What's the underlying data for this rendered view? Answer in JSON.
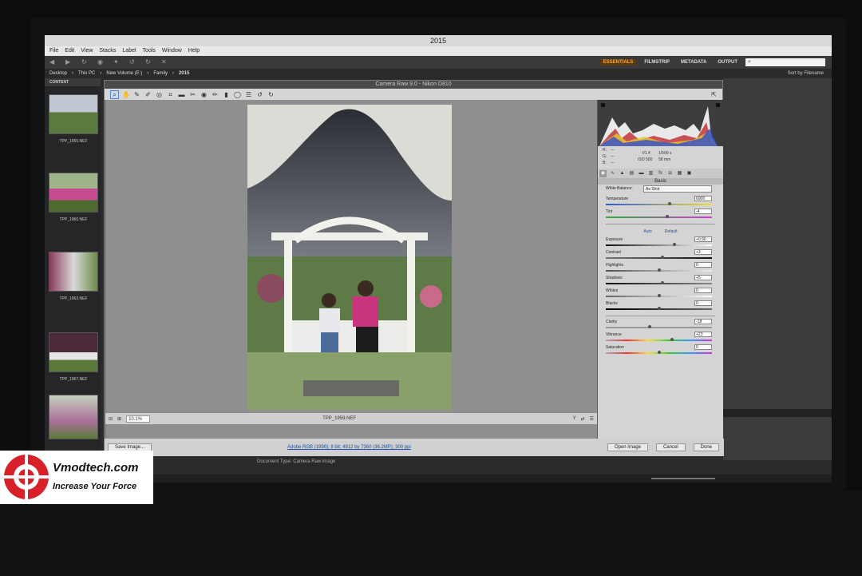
{
  "window": {
    "title": "2015"
  },
  "menu": [
    "File",
    "Edit",
    "View",
    "Stacks",
    "Label",
    "Tools",
    "Window",
    "Help"
  ],
  "workspaces": [
    "ESSENTIALS",
    "FILMSTRIP",
    "METADATA",
    "OUTPUT"
  ],
  "path": [
    "Desktop",
    "This PC",
    "New Volume (E:)",
    "Family",
    "2015"
  ],
  "sort_label": "Sort by Filename",
  "left_panel": {
    "tab": "CONTENT",
    "thumbs": [
      "TPP_1955.NEF",
      "TPP_1960.NEF",
      "TPP_1963.NEF",
      "TPP_1967.NEF"
    ]
  },
  "dialog": {
    "title": "Camera Raw 9.0 - Nikon D810",
    "zoom": "10.1%",
    "filename": "TPP_1959.NEF",
    "readout": {
      "r_label": "R:",
      "g_label": "G:",
      "b_label": "B:",
      "aperture": "f/1.4",
      "shutter": "1/500 s",
      "iso": "ISO 500",
      "focal": "58 mm",
      "dash": "---"
    },
    "basic_title": "Basic",
    "white_balance": {
      "label": "White Balance:",
      "value": "As Shot"
    },
    "temperature": {
      "label": "Temperature",
      "value": "6000"
    },
    "tint": {
      "label": "Tint",
      "value": "-4"
    },
    "auto": "Auto",
    "default": "Default",
    "exposure": {
      "label": "Exposure",
      "value": "+0.90"
    },
    "contrast": {
      "label": "Contrast",
      "value": "+3"
    },
    "highlights": {
      "label": "Highlights",
      "value": "0"
    },
    "shadows": {
      "label": "Shadows",
      "value": "+5"
    },
    "whites": {
      "label": "Whites",
      "value": "0"
    },
    "blacks": {
      "label": "Blacks",
      "value": "0"
    },
    "clarity": {
      "label": "Clarity",
      "value": "-18"
    },
    "vibrance": {
      "label": "Vibrance",
      "value": "+23"
    },
    "saturation": {
      "label": "Saturation",
      "value": "0"
    },
    "save_button": "Save Image...",
    "info_link": "Adobe RGB (1998); 8 bit; 4912 by 7360 (36.2MP); 300 ppi",
    "open_button": "Open Image",
    "cancel_button": "Cancel",
    "done_button": "Done"
  },
  "doc_type": "Document Type: Camera Raw image",
  "watermark": {
    "brand": "Vmodtech.com",
    "tagline": "Increase Your Force"
  },
  "colors": {
    "accent": "#f3a943",
    "link": "#1c4ea8"
  }
}
